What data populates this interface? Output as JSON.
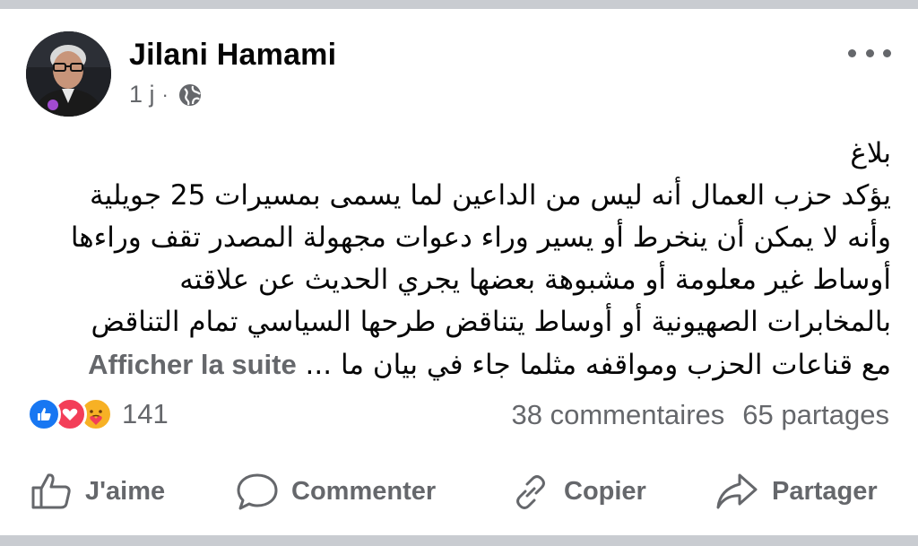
{
  "post": {
    "author_name": "Jilani Hamami",
    "timestamp": "1 j",
    "separator": "·",
    "audience_icon": "globe-icon",
    "more_icon": "more-horizontal-icon",
    "text_lines": [
      "بلاغ",
      "يؤكد حزب العمال أنه ليس من الداعين لما يسمى بمسيرات 25 جويلية",
      "وأنه لا يمكن أن ينخرط أو يسير وراء دعوات مجهولة المصدر تقف وراءها",
      "أوساط غير معلومة أو مشبوهة بعضها يجري الحديث عن علاقته",
      "بالمخابرات الصهيونية أو أوساط يتناقض طرحها السياسي تمام التناقض",
      "مع قناعات الحزب ومواقفه مثلما جاء في بيان ما ..."
    ],
    "see_more": "Afficher la suite"
  },
  "engagement": {
    "reaction_icons": [
      "like-reaction-icon",
      "love-reaction-icon",
      "care-reaction-icon"
    ],
    "reaction_count": "141",
    "comments": "38 commentaires",
    "shares": "65 partages"
  },
  "actions": {
    "like_label": "J'aime",
    "comment_label": "Commenter",
    "copy_label": "Copier",
    "share_label": "Partager"
  },
  "colors": {
    "secondary_text": "#65676b",
    "like_blue": "#1877f2",
    "love_red": "#f33e58",
    "care_yellow": "#f7b125",
    "divider": "#c9ccd1"
  }
}
